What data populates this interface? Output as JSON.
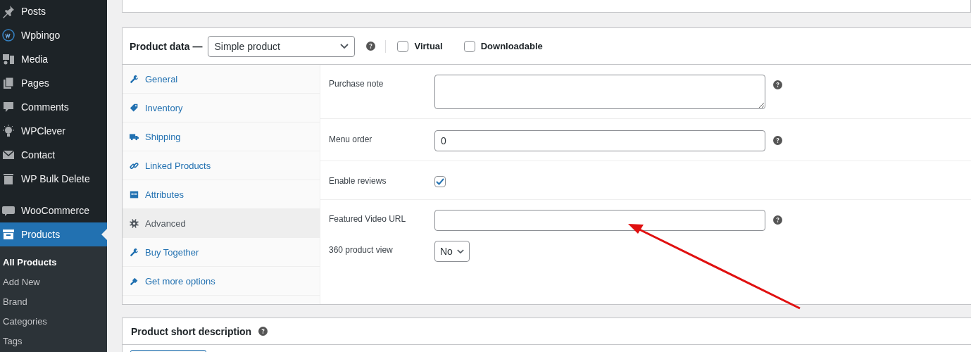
{
  "sidebar": {
    "items": [
      {
        "label": "Posts",
        "selected": false
      },
      {
        "label": "Wpbingo",
        "selected": false
      },
      {
        "label": "Media",
        "selected": false
      },
      {
        "label": "Pages",
        "selected": false
      },
      {
        "label": "Comments",
        "selected": false
      },
      {
        "label": "WPClever",
        "selected": false
      },
      {
        "label": "Contact",
        "selected": false
      },
      {
        "label": "WP Bulk Delete",
        "selected": false
      },
      {
        "label": "WooCommerce",
        "selected": false
      },
      {
        "label": "Products",
        "selected": true
      }
    ],
    "submenu": [
      {
        "label": "All Products",
        "selected": true
      },
      {
        "label": "Add New",
        "selected": false
      },
      {
        "label": "Brand",
        "selected": false
      },
      {
        "label": "Categories",
        "selected": false
      },
      {
        "label": "Tags",
        "selected": false
      }
    ]
  },
  "product_data": {
    "title": "Product data —",
    "type_select": "Simple product",
    "options": [
      {
        "label": "Virtual",
        "checked": false
      },
      {
        "label": "Downloadable",
        "checked": false
      }
    ],
    "tabs": [
      {
        "label": "General",
        "selected": false
      },
      {
        "label": "Inventory",
        "selected": false
      },
      {
        "label": "Shipping",
        "selected": false
      },
      {
        "label": "Linked Products",
        "selected": false
      },
      {
        "label": "Attributes",
        "selected": false
      },
      {
        "label": "Advanced",
        "selected": true
      },
      {
        "label": "Buy Together",
        "selected": false
      },
      {
        "label": "Get more options",
        "selected": false
      }
    ],
    "fields": [
      {
        "kind": "textarea",
        "label": "Purchase note",
        "help": true
      },
      {
        "kind": "text",
        "label": "Menu order",
        "value": "0",
        "help": true
      },
      {
        "kind": "checkbox",
        "label": "Enable reviews",
        "checked": true,
        "help": false
      },
      {
        "kind": "text",
        "label": "Featured Video URL",
        "help": true
      },
      {
        "kind": "select",
        "label": "360 product view",
        "value": "No",
        "help": false
      }
    ]
  },
  "short_description": {
    "title": "Product short description"
  }
}
